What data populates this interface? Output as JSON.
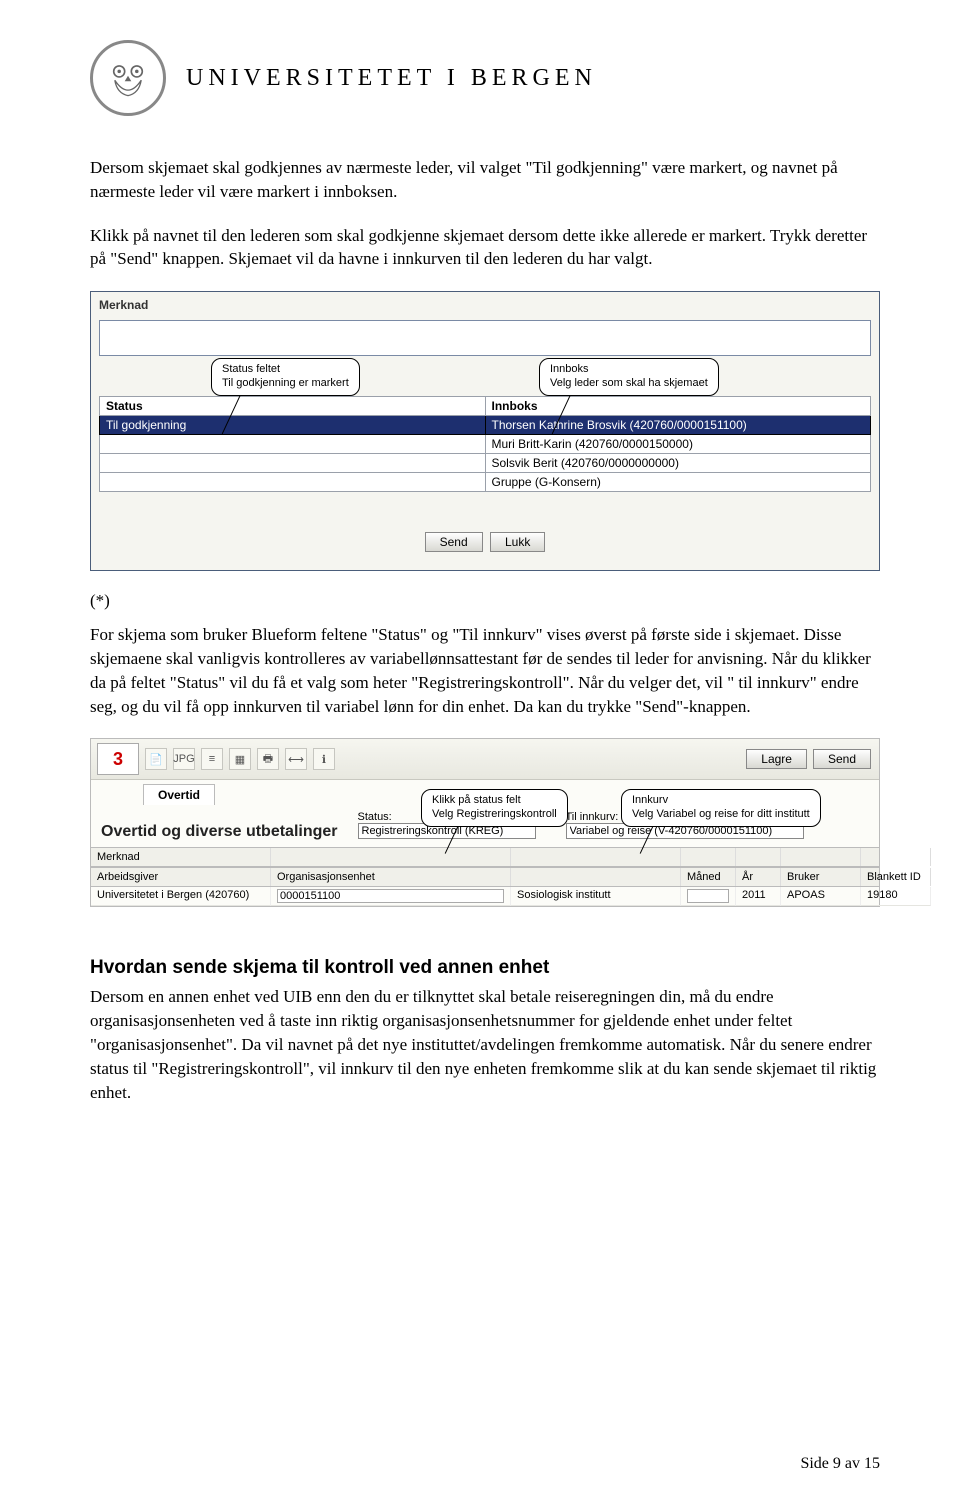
{
  "header": {
    "university": "UNIVERSITETET I BERGEN"
  },
  "para1": "Dersom skjemaet skal godkjennes av nærmeste leder, vil valget \"Til godkjenning\" være markert, og navnet på nærmeste leder vil være markert i innboksen.",
  "para2": "Klikk på navnet til den lederen som skal godkjenne skjemaet dersom dette ikke allerede er markert. Trykk deretter på \"Send\" knappen. Skjemaet vil da havne i innkurven til den lederen du har valgt.",
  "callouts": {
    "status": {
      "l1": "Status feltet",
      "l2": "Til godkjenning er markert"
    },
    "innboks": {
      "l1": "Innboks",
      "l2": "Velg leder som skal ha skjemaet"
    },
    "klikk": {
      "l1": "Klikk på status felt",
      "l2": "Velg Registreringskontroll"
    },
    "innkurv": {
      "l1": "Innkurv",
      "l2": "Velg Variabel og reise for ditt institutt"
    }
  },
  "shot1": {
    "merknad_label": "Merknad",
    "status_label": "Status",
    "innboks_label": "Innboks",
    "status_value": "Til godkjenning",
    "rows": [
      "Thorsen Kathrine Brosvik (420760/0000151100)",
      "Muri Britt-Karin (420760/0000150000)",
      "Solsvik Berit (420760/0000000000)",
      "Gruppe (G-Konsern)"
    ],
    "send": "Send",
    "lukk": "Lukk"
  },
  "asterisk": "(*)",
  "para3": "For skjema som bruker Blueform feltene \"Status\" og \"Til innkurv\" vises øverst på første side i skjemaet. Disse skjemaene skal vanligvis kontrolleres av variabellønnsattestant før de sendes til leder for anvisning. Når du klikker da på feltet \"Status\" vil du få et valg som heter \"Registreringskontroll\". Når du velger det, vil \" til innkurv\" endre seg, og du vil få opp innkurven til variabel lønn for din enhet. Da kan du trykke \"Send\"-knappen.",
  "shot2": {
    "lagre": "Lagre",
    "send": "Send",
    "tab": "Overtid",
    "title": "Overtid og diverse utbetalinger",
    "status_label": "Status:",
    "status_value": "Registreringskontroll (KREG)",
    "tilinn_label": "Til innkurv:",
    "tilinn_value": "Variabel og reise (V-420760/0000151100)",
    "headers": {
      "merknad": "Merknad",
      "arbeidsgiver": "Arbeidsgiver",
      "org": "Organisasjonsenhet",
      "maned": "Måned",
      "ar": "År",
      "bruker": "Bruker",
      "blankett": "Blankett ID"
    },
    "row": {
      "arbeidsgiver": "Universitetet i Bergen (420760)",
      "org_kode": "0000151100",
      "org_navn": "Sosiologisk institutt",
      "maned": "",
      "ar": "2011",
      "bruker": "APOAS",
      "blankett": "19180"
    }
  },
  "section_title": "Hvordan sende skjema til kontroll ved annen enhet",
  "para4": "Dersom en annen enhet ved UIB enn den du er tilknyttet skal betale reiseregningen din, må du endre organisasjonsenheten ved å taste inn riktig organisasjonsenhetsnummer for gjeldende enhet under feltet \"organisasjonsenhet\". Da vil navnet på det nye instituttet/avdelingen fremkomme automatisk. Når du senere endrer status til \"Registreringskontroll\", vil innkurv til den nye enheten fremkomme slik at du kan sende skjemaet til riktig enhet.",
  "footer": "Side 9 av 15"
}
